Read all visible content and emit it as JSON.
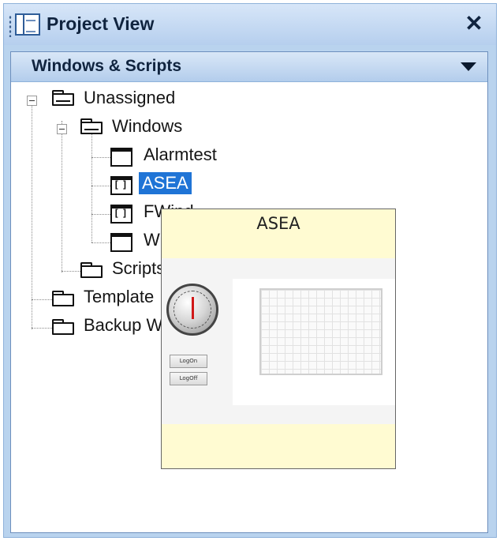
{
  "panel": {
    "title": "Project View",
    "close_glyph": "✕"
  },
  "section": {
    "title": "Windows & Scripts"
  },
  "tree": {
    "unassigned": "Unassigned",
    "windows": "Windows",
    "alarmtest": "Alarmtest",
    "asea": "ASEA",
    "fwind": "FWind",
    "wi": "Wi",
    "scripts": "Scripts",
    "templates": "Template",
    "backup": "Backup W"
  },
  "preview": {
    "title": "ASEA",
    "logon_label": "LogOn",
    "logoff_label": "LogOff"
  },
  "colors": {
    "selection": "#1f74d6",
    "header_gradient_top": "#d9e7f7",
    "header_gradient_bottom": "#b3cdec",
    "preview_background": "#fffbd2"
  }
}
